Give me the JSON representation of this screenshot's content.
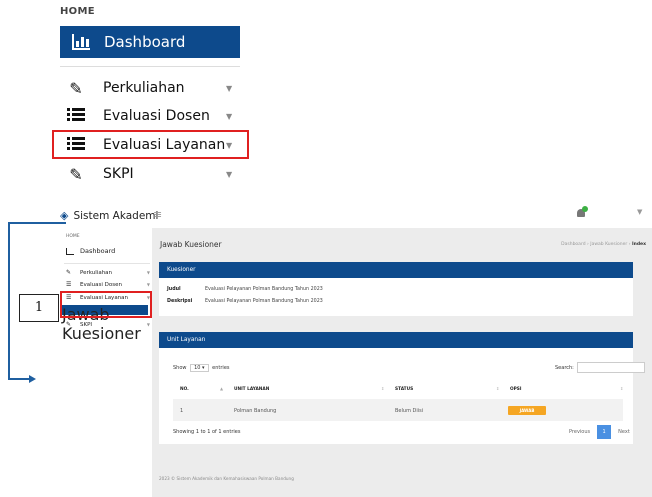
{
  "zoom": {
    "home_label": "HOME",
    "dashboard_label": "Dashboard",
    "items": [
      {
        "label": "Perkuliahan",
        "icon": "pencil-icon"
      },
      {
        "label": "Evaluasi Dosen",
        "icon": "list-icon"
      },
      {
        "label": "Evaluasi Layanan",
        "icon": "list-icon"
      },
      {
        "label": "SKPI",
        "icon": "pencil-icon"
      }
    ]
  },
  "app": {
    "brand": "Sistem Akademi",
    "home_label": "HOME",
    "dashboard_label": "Dashboard",
    "sidebar_items": [
      {
        "label": "Perkuliahan"
      },
      {
        "label": "Evaluasi Dosen"
      },
      {
        "label": "Evaluasi Layanan"
      },
      {
        "label": "SKPI"
      }
    ],
    "active_subitem": "Jawab Kuesioner",
    "page_title": "Jawab Kuesioner",
    "breadcrumb": {
      "a": "Dashboard",
      "sep1": "›",
      "b": "Jawab Kuesioner",
      "sep2": "›",
      "c": "Index"
    },
    "kuesioner": {
      "header": "Kuesioner",
      "judul_label": "Judul",
      "judul_value": "Evaluasi Pelayanan Polman Bandung Tahun 2023",
      "deskripsi_label": "Deskripsi",
      "deskripsi_value": "Evaluasi Pelayanan Polman Bandung Tahun 2023"
    },
    "unit": {
      "header": "Unit Layanan",
      "show_label": "Show",
      "entries_value": "10",
      "entries_label": "entries",
      "search_label": "Search:",
      "columns": [
        "NO.",
        "UNIT LAYANAN",
        "STATUS",
        "OPSI"
      ],
      "rows": [
        {
          "no": "1",
          "unit": "Polman Bandung",
          "status": "Belum Diisi",
          "action": "JAWAB"
        }
      ],
      "info": "Showing 1 to 1 of 1 entries",
      "previous": "Previous",
      "page": "1",
      "next": "Next"
    },
    "footer": "2023 © Sistem Akademik dan Kemahasiswaan Polman Bandung"
  },
  "annotation": {
    "step_number": "1"
  },
  "colors": {
    "primary": "#0d4a8c",
    "highlight": "#e02020",
    "action_button": "#f5a623",
    "page_active": "#4a90e2"
  }
}
